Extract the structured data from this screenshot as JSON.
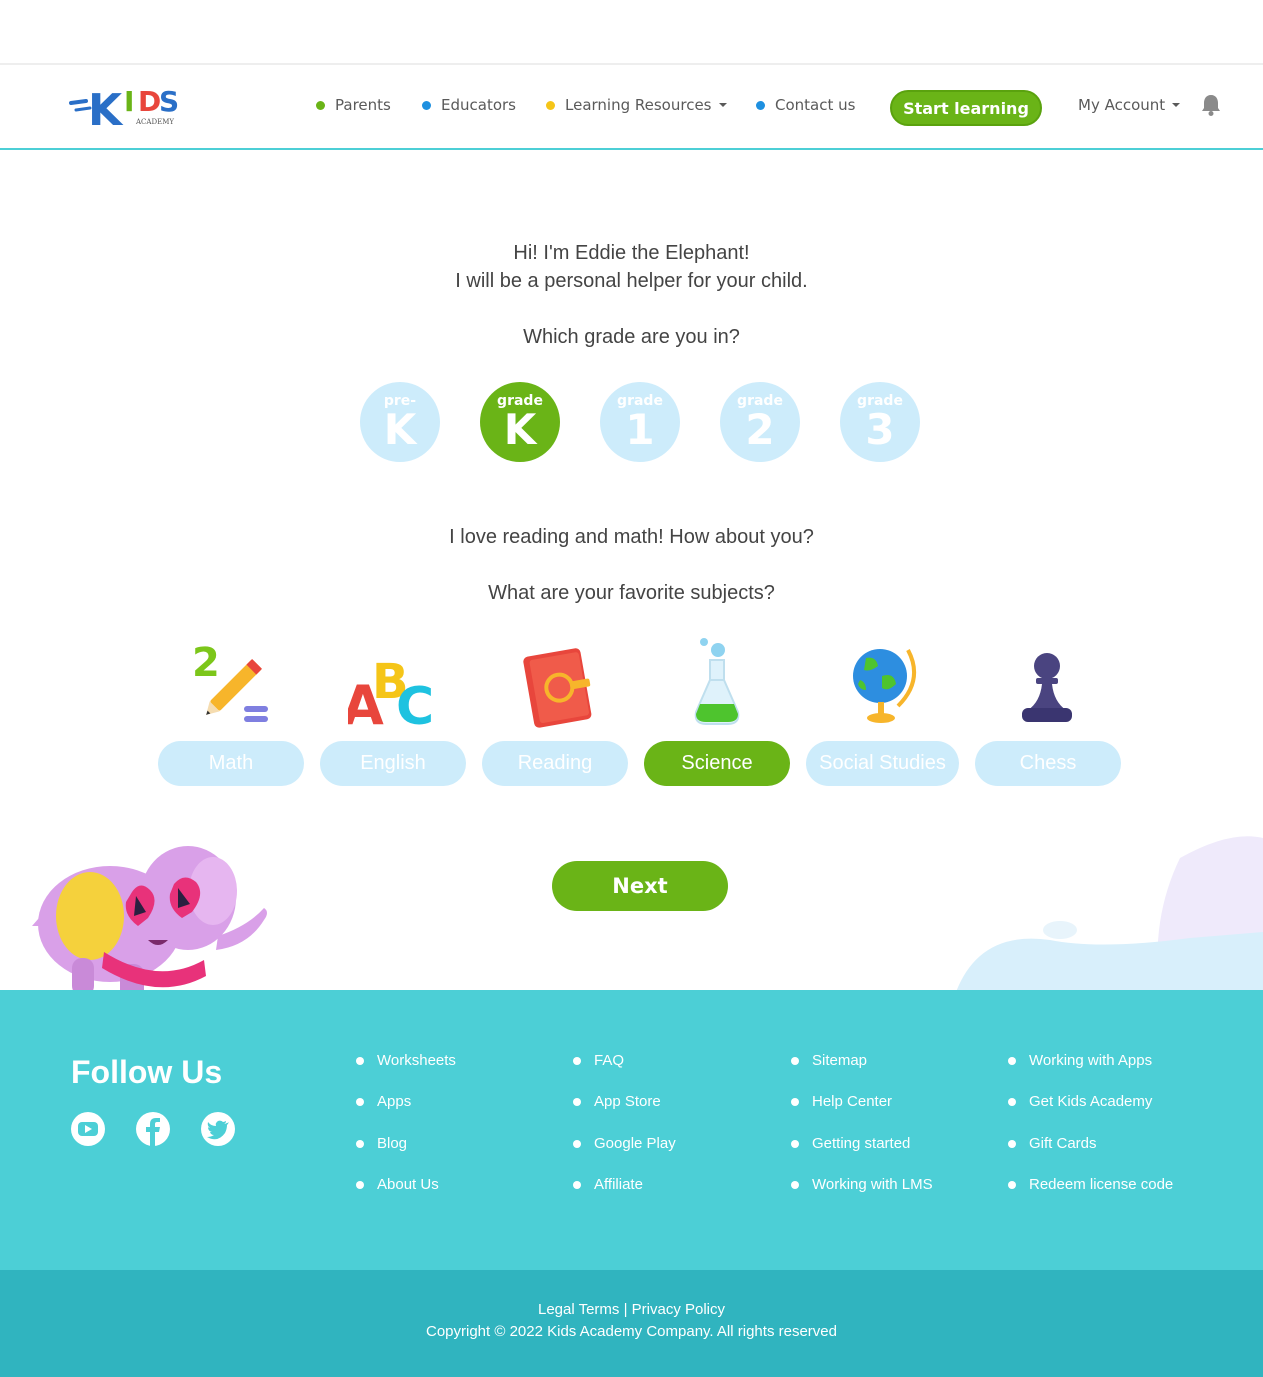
{
  "brand": {
    "logo_letters": [
      "K",
      "I",
      "D",
      "S"
    ],
    "logo_sub": "ACADEMY"
  },
  "nav": {
    "items": [
      {
        "label": "Parents",
        "dot": "#6ab417"
      },
      {
        "label": "Educators",
        "dot": "#1e90e0"
      },
      {
        "label": "Learning Resources",
        "dot": "#f5c518"
      },
      {
        "label": "Contact us",
        "dot": "#1e90e0"
      }
    ],
    "start_label": "Start learning",
    "account_label": "My Account"
  },
  "intro": {
    "line1": "Hi! I'm Eddie the Elephant!",
    "line2": "I will be a personal helper for your child.",
    "grade_question": "Which grade are you in?",
    "love_line": "I love reading and math! How about you?",
    "subject_question": "What are your favorite subjects?"
  },
  "grades": [
    {
      "small": "pre-",
      "big": "K",
      "selected": false
    },
    {
      "small": "grade",
      "big": "K",
      "selected": true
    },
    {
      "small": "grade",
      "big": "1",
      "selected": false
    },
    {
      "small": "grade",
      "big": "2",
      "selected": false
    },
    {
      "small": "grade",
      "big": "3",
      "selected": false
    }
  ],
  "subjects": [
    {
      "label": "Math",
      "icon": "pencil-icon",
      "selected": false
    },
    {
      "label": "English",
      "icon": "abc-icon",
      "selected": false
    },
    {
      "label": "Reading",
      "icon": "book-icon",
      "selected": false
    },
    {
      "label": "Science",
      "icon": "flask-icon",
      "selected": true
    },
    {
      "label": "Social Studies",
      "icon": "globe-icon",
      "selected": false
    },
    {
      "label": "Chess",
      "icon": "chess-pawn-icon",
      "selected": false
    }
  ],
  "next_label": "Next",
  "footer": {
    "follow_title": "Follow Us",
    "social": [
      "youtube-icon",
      "facebook-icon",
      "twitter-icon"
    ],
    "columns": [
      [
        "Worksheets",
        "Apps",
        "Blog",
        "About Us"
      ],
      [
        "FAQ",
        "App Store",
        "Google Play",
        "Affiliate"
      ],
      [
        "Sitemap",
        "Help Center",
        "Getting started",
        "Working with LMS"
      ],
      [
        "Working with Apps",
        "Get Kids Academy",
        "Gift Cards",
        "Redeem license code"
      ]
    ],
    "legal": "Legal Terms | Privacy Policy",
    "copyright": "Copyright © 2022 Kids Academy Company. All rights reserved"
  },
  "colors": {
    "accent": "#6ab417",
    "light_blue": "#cdecfb",
    "teal": "#4ccfd6",
    "teal_dark": "#30b4bf"
  }
}
